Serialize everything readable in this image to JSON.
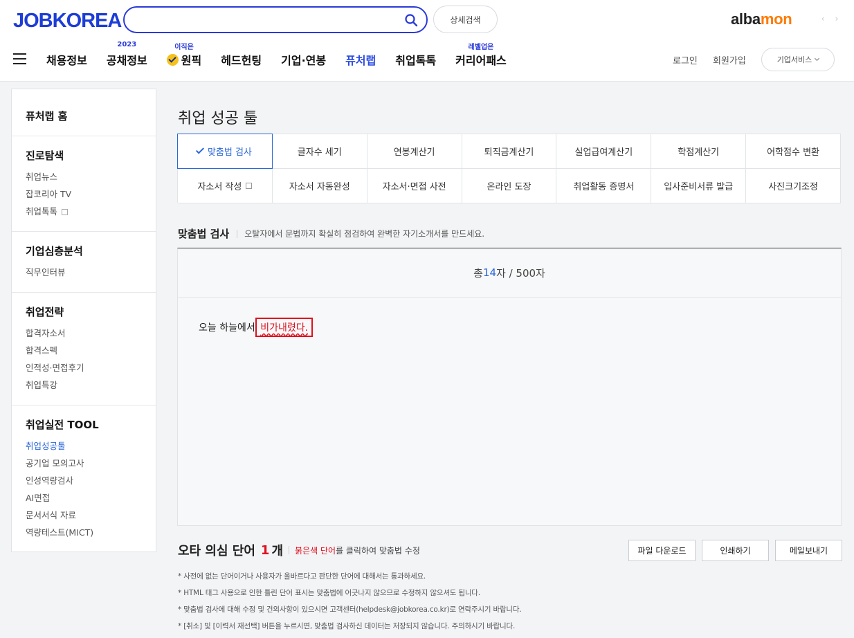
{
  "header": {
    "logo": {
      "prefix": "JOB",
      "highlight": "KO",
      "suffix": "REA"
    },
    "search": {
      "value": "",
      "placeholder": ""
    },
    "advanced_search": "상세검색",
    "albamon": {
      "a": "alba",
      "o": "mon"
    },
    "arrows": [
      "‹",
      "›"
    ],
    "nav": [
      {
        "label": "채용정보",
        "sup": ""
      },
      {
        "label": "공채정보",
        "sup": "2023"
      },
      {
        "label": "원픽",
        "sup": "이직은"
      },
      {
        "label": "헤드헌팅",
        "sup": ""
      },
      {
        "label": "기업·연봉",
        "sup": ""
      },
      {
        "label": "퓨처랩",
        "sup": ""
      },
      {
        "label": "취업톡톡",
        "sup": ""
      },
      {
        "label": "커리어패스",
        "sup": "레벨업은"
      }
    ],
    "login": "로그인",
    "signup": "회원가입",
    "biz_service": "기업서비스"
  },
  "sidebar": {
    "home": "퓨처랩 홈",
    "sections": [
      {
        "title": "진로탐색",
        "links": [
          "취업뉴스",
          "잡코리아 TV",
          "취업톡톡"
        ]
      },
      {
        "title": "기업심층분석",
        "links": [
          "직무인터뷰"
        ]
      },
      {
        "title": "취업전략",
        "links": [
          "합격자소서",
          "합격스펙",
          "인적성·면접후기",
          "취업특강"
        ]
      },
      {
        "title": "취업실전 TOOL",
        "links": [
          "취업성공툴",
          "공기업 모의고사",
          "인성역량검사",
          "AI면접",
          "문서서식 자료",
          "역량테스트(MICT)"
        ]
      }
    ]
  },
  "main": {
    "page_title": "취업 성공 툴",
    "tools": [
      "맞춤법 검사",
      "글자수 세기",
      "연봉계산기",
      "퇴직금계산기",
      "실업급여계산기",
      "학점계산기",
      "어학점수 변환",
      "자소서 작성",
      "자소서 자동완성",
      "자소서·면접 사전",
      "온라인 도장",
      "취업활동 증명서",
      "입사준비서류 발급",
      "사진크기조정"
    ],
    "section_title": "맞춤법 검사",
    "section_desc": "오탈자에서 문법까지 확실히 점검하여 완벽한 자기소개서를 만드세요.",
    "count": {
      "prefix": "총 ",
      "num": "14",
      "suffix": "자 / 500자"
    },
    "text": {
      "normal": "오늘 하늘에서 ",
      "typo": "비가내렸다."
    },
    "typo_head": {
      "title": "오타 의심 단어",
      "count": "1",
      "unit": "개",
      "red": "붉은색 단어",
      "desc": "를 클릭하여 맞춤법 수정"
    },
    "buttons": {
      "download": "파일 다운로드",
      "print": "인쇄하기",
      "mail": "메일보내기"
    },
    "notes": [
      "* 사전에 없는 단어이거나 사용자가 올바르다고 판단한 단어에 대해서는 통과하세요.",
      "* HTML 태그 사용으로 인한 틀린 단어 표시는 맞춤법에 어긋나지 않으므로 수정하지 않으셔도 됩니다.",
      "* 맞춤법 검사에 대해 수정 및 건의사항이 있으시면 고객센터(helpdesk@jobkorea.co.kr)로 연락주시기 바랍니다.",
      "* [취소] 및 [이력서 재선택] 버튼을 누르시면, 맞춤법 검사하신 데이터는 저장되지 않습니다. 주의하시기 바랍니다."
    ]
  }
}
